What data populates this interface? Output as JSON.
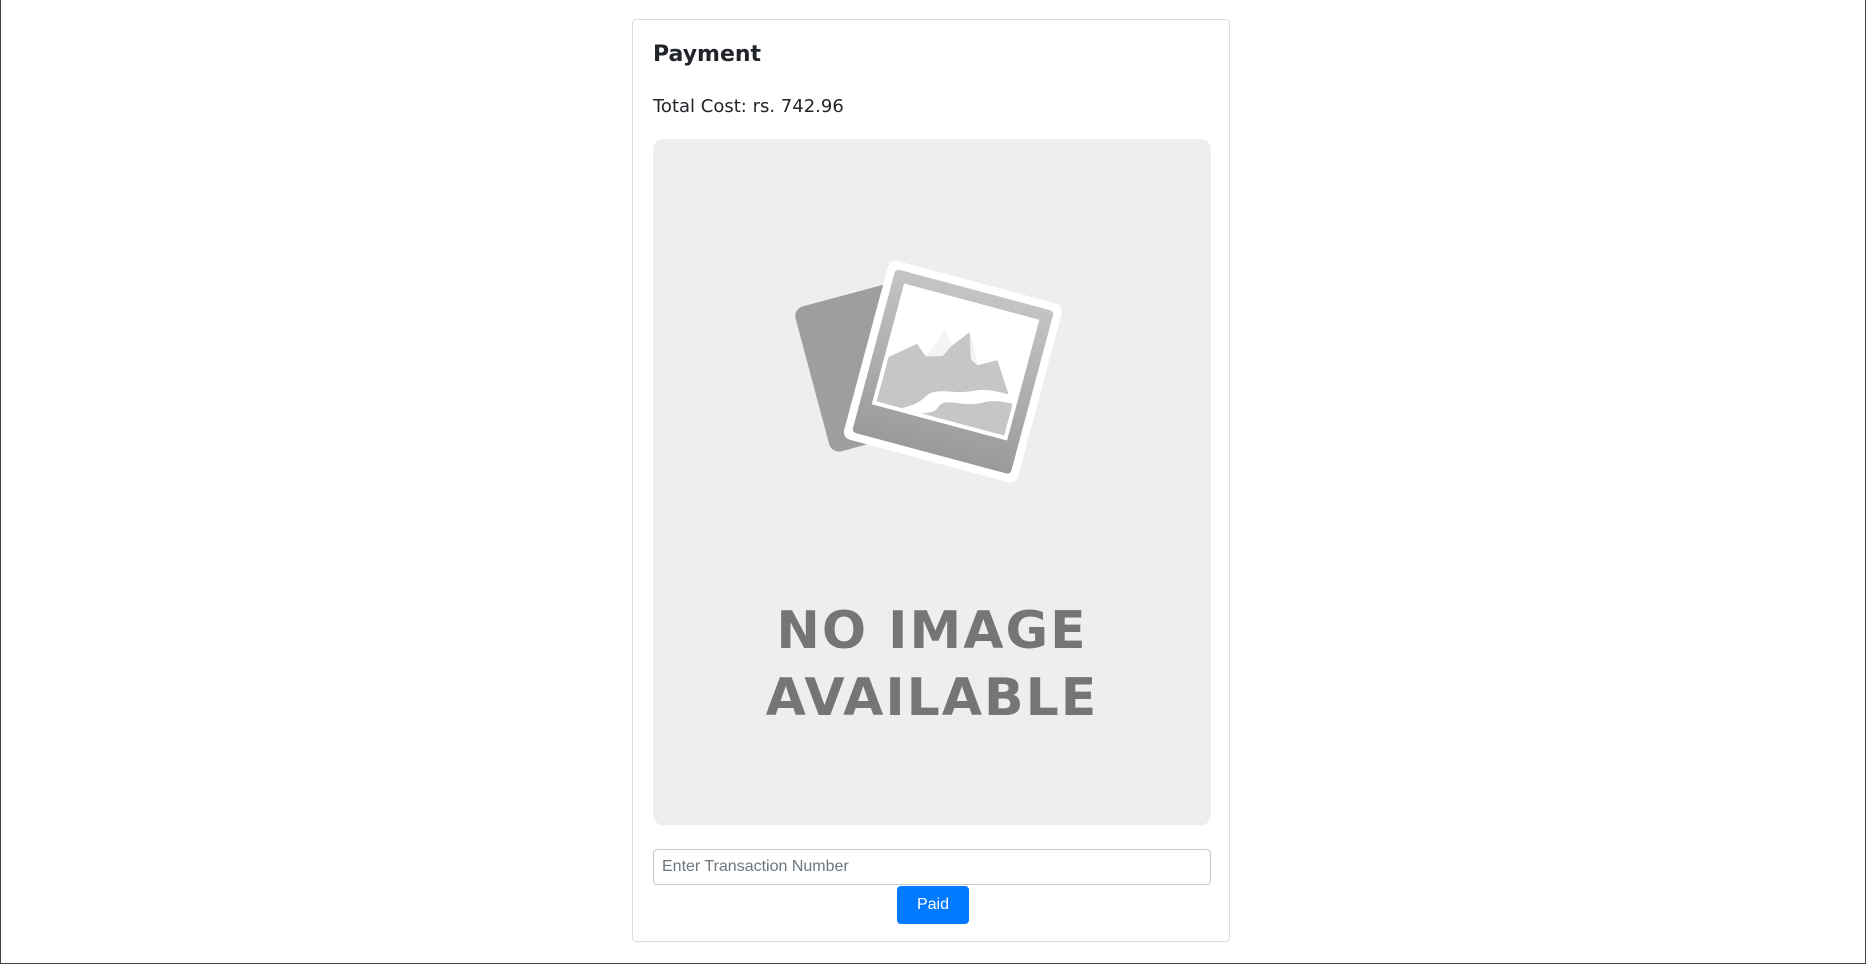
{
  "payment": {
    "title": "Payment",
    "total_cost": "Total Cost: rs. 742.96",
    "image": {
      "placeholder_line1": "NO IMAGE",
      "placeholder_line2": "AVAILABLE",
      "icon": "photo-placeholder-icon"
    },
    "transaction_input": {
      "value": "",
      "placeholder": "Enter Transaction Number"
    },
    "paid_label": "Paid"
  },
  "colors": {
    "primary": "#007bff",
    "placeholder_bg": "#eeeeee",
    "placeholder_text": "#757575"
  }
}
